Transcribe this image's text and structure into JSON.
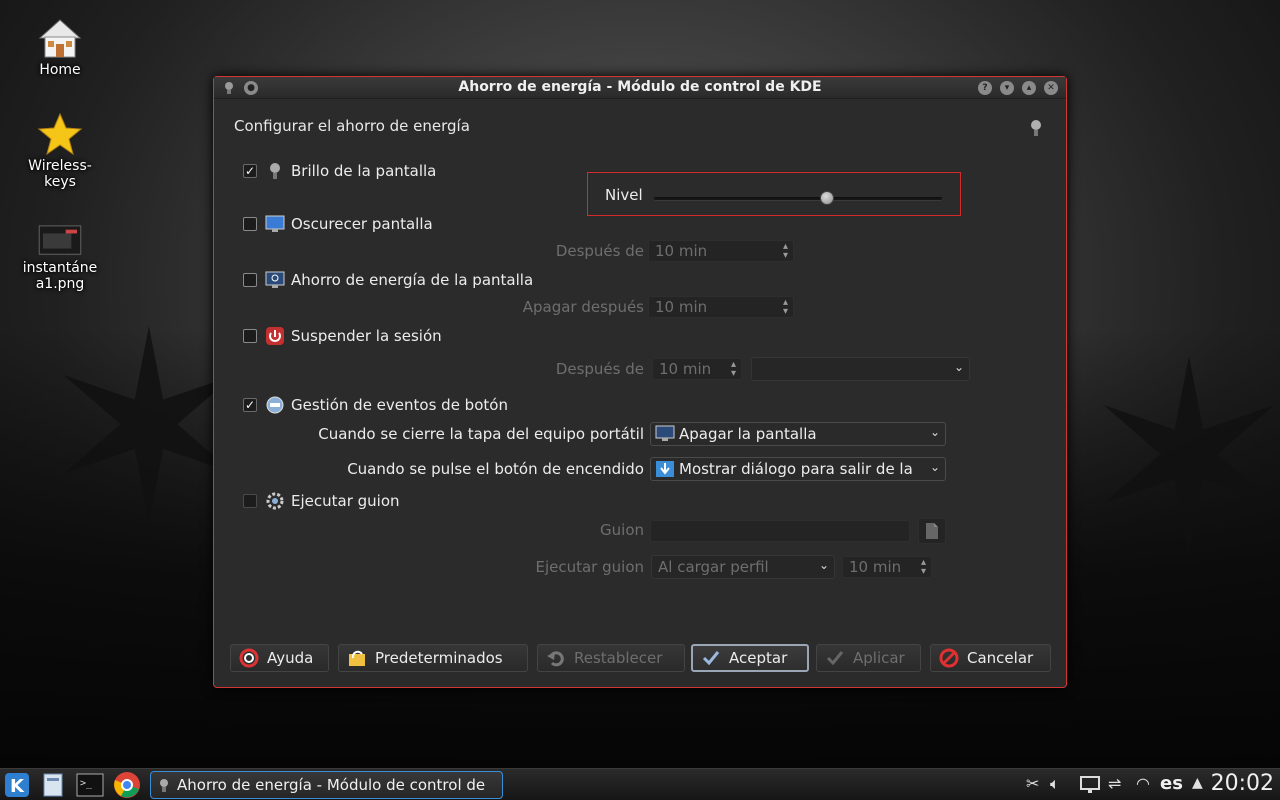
{
  "desktop": {
    "icons": [
      {
        "label": "Home"
      },
      {
        "label": "Wireless-\nkeys"
      },
      {
        "label": "instantáne\na1.png"
      }
    ]
  },
  "window": {
    "title": "Ahorro de energía - Módulo de control de KDE",
    "header": "Configurar el ahorro de energía",
    "nivel_label": "Nivel",
    "brightness_level": 0.6,
    "sections": {
      "brillo": {
        "label": "Brillo de la pantalla",
        "checked": true
      },
      "oscurecer": {
        "label": "Oscurecer pantalla",
        "checked": false,
        "after_label": "Después de",
        "after_value": "10 min"
      },
      "ahorro": {
        "label": "Ahorro de energía de la pantalla",
        "checked": false,
        "after_label": "Apagar después",
        "after_value": "10 min"
      },
      "suspender": {
        "label": "Suspender la sesión",
        "checked": false,
        "after_label": "Después de",
        "after_value": "10 min",
        "action_value": ""
      },
      "gestion": {
        "label": "Gestión de eventos de botón",
        "checked": true,
        "lid_label": "Cuando se cierre la tapa del equipo portátil",
        "lid_value": "Apagar la pantalla",
        "power_label": "Cuando se pulse el botón de encendido",
        "power_value": "Mostrar diálogo para salir de la"
      },
      "guion": {
        "label": "Ejecutar guion",
        "checked": false,
        "script_label": "Guion",
        "script_value": "",
        "run_label": "Ejecutar guion",
        "run_value": "Al cargar perfil",
        "run_time": "10 min"
      }
    },
    "buttons": {
      "help": "Ayuda",
      "defaults": "Predeterminados",
      "reset": "Restablecer",
      "ok": "Aceptar",
      "apply": "Aplicar",
      "cancel": "Cancelar"
    }
  },
  "taskbar": {
    "task": "Ahorro de energía - Módulo de control de",
    "language": "es",
    "clock": "20:02"
  }
}
